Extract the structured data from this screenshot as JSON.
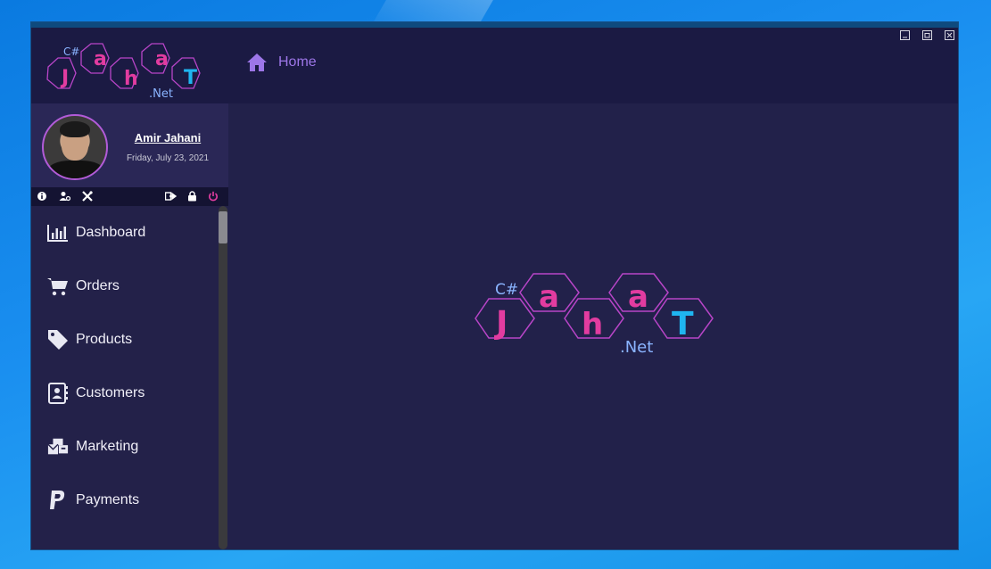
{
  "logo": {
    "csharp": "C#",
    "letters": [
      "J",
      "a",
      "h",
      "a",
      "T"
    ],
    "net": ".Net"
  },
  "user": {
    "name": "Amir Jahani",
    "date": "Friday, July 23, 2021"
  },
  "toolbar": {
    "left_icons": [
      "info-icon",
      "user-settings-icon",
      "tools-icon"
    ],
    "right_icons": [
      "logout-icon",
      "lock-icon",
      "power-icon"
    ]
  },
  "breadcrumb": {
    "label": "Home"
  },
  "menu": [
    {
      "label": "Dashboard",
      "icon": "chart-bars-icon"
    },
    {
      "label": "Orders",
      "icon": "cart-icon"
    },
    {
      "label": "Products",
      "icon": "tag-icon"
    },
    {
      "label": "Customers",
      "icon": "contact-book-icon"
    },
    {
      "label": "Marketing",
      "icon": "mail-bulk-icon"
    },
    {
      "label": "Payments",
      "icon": "paypal-icon"
    }
  ],
  "colors": {
    "accent": "#9d76e8",
    "pink": "#e23ca0",
    "cyan": "#1fb5f0",
    "window": "#22214a",
    "sidebar": "#232149"
  }
}
